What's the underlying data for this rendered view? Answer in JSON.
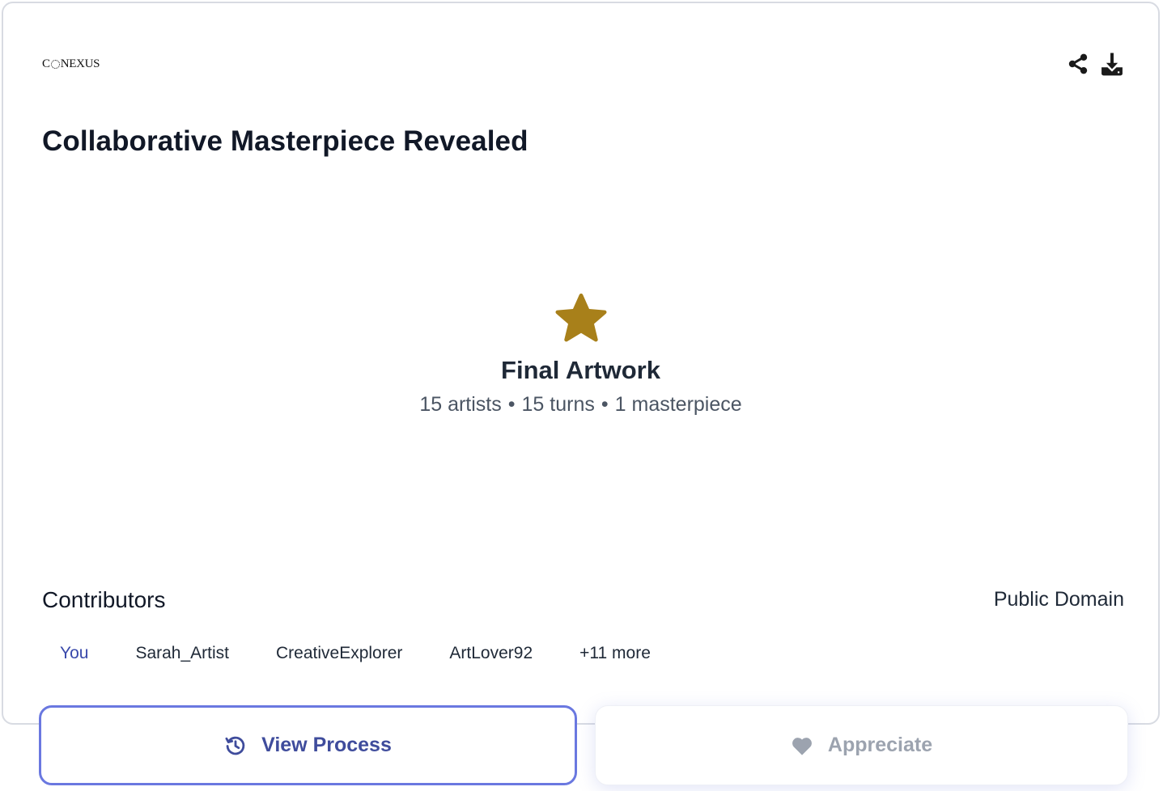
{
  "brand": {
    "logo_prefix": "C",
    "logo_suffix": "NEXUS"
  },
  "header": {
    "title": "Collaborative Masterpiece Revealed",
    "actions": [
      {
        "icon": "share-icon"
      },
      {
        "icon": "download-icon"
      }
    ]
  },
  "artwork": {
    "icon": "star-icon",
    "icon_color": "#a8801a",
    "label": "Final Artwork",
    "stats": {
      "artists": "15 artists",
      "turns": "15 turns",
      "result": "1 masterpiece",
      "separator": "•"
    }
  },
  "contributors": {
    "heading": "Contributors",
    "license": "Public Domain",
    "items": [
      "You",
      "Sarah_Artist",
      "CreativeExplorer",
      "ArtLover92"
    ],
    "more": "+11 more"
  },
  "actions": {
    "view_process": {
      "label": "View Process",
      "icon": "history-icon",
      "color": "#3f4c9c"
    },
    "appreciate": {
      "label": "Appreciate",
      "icon": "heart-icon",
      "color": "#9ca3af"
    }
  }
}
